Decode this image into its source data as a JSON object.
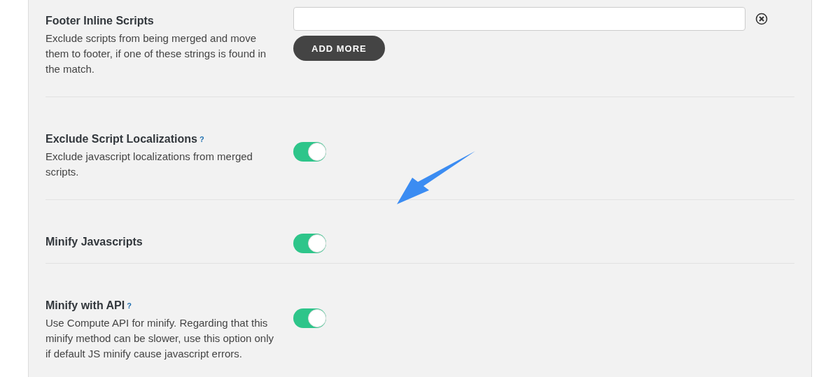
{
  "settings": [
    {
      "kind": "text-list",
      "title": "Footer Inline Scripts",
      "description": "Exclude scripts from being merged and move them to footer, if one of these strings is found in the match.",
      "button": "ADD MORE"
    },
    {
      "kind": "toggle",
      "title": "Exclude Script Localizations",
      "help": "?",
      "description": "Exclude javascript localizations from merged scripts.",
      "on": true
    },
    {
      "kind": "toggle",
      "title": "Minify Javascripts",
      "on": true
    },
    {
      "kind": "toggle",
      "title": "Minify with API",
      "help": "?",
      "description": "Use Compute API for minify. Regarding that this minify method can be slower, use this option only if default JS minify cause javascript errors.",
      "on": true
    }
  ]
}
